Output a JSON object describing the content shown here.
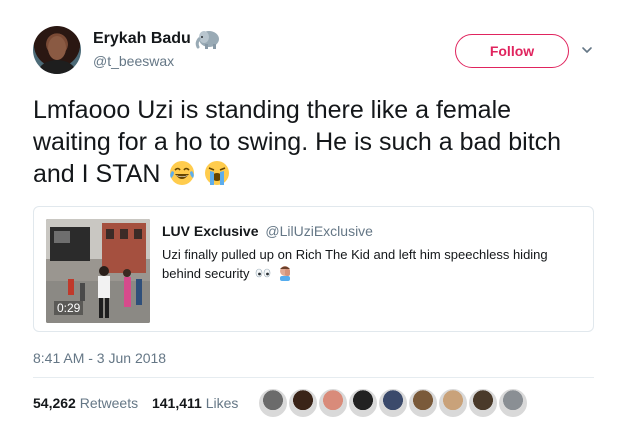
{
  "author": {
    "display_name": "Erykah Badu",
    "handle": "@t_beeswax",
    "badge_icon": "elephant-emoji-icon"
  },
  "actions": {
    "follow_label": "Follow",
    "menu_icon": "chevron-down-icon"
  },
  "tweet": {
    "text": "Lmfaooo Uzi is standing there like a female waiting for a ho to swing. He is such a bad bitch and I STAN",
    "emojis": [
      "face-with-tears-of-joy-icon",
      "loudly-crying-face-icon"
    ]
  },
  "quoted": {
    "name": "LUV Exclusive",
    "handle": "@LilUziExclusive",
    "text": "Uzi finally pulled up on Rich The Kid and left him speechless hiding behind security",
    "emojis": [
      "eyes-icon",
      "man-facepalming-icon"
    ],
    "video_duration": "0:29"
  },
  "timestamp": "8:41 AM - 3 Jun 2018",
  "stats": {
    "retweets_count": "54,262",
    "retweets_label": "Retweets",
    "likes_count": "141,411",
    "likes_label": "Likes"
  },
  "likers": {
    "count_shown": 9,
    "colors": [
      "#6b6b6b",
      "#3a2418",
      "#d98b7a",
      "#222222",
      "#3b4a6b",
      "#7a5a3a",
      "#c9a27a",
      "#4a3a2a",
      "#8a8f94"
    ]
  },
  "colors": {
    "follow_accent": "#e0245e",
    "secondary_text": "#657786",
    "primary_text": "#14171a",
    "border": "#e1e8ed"
  }
}
